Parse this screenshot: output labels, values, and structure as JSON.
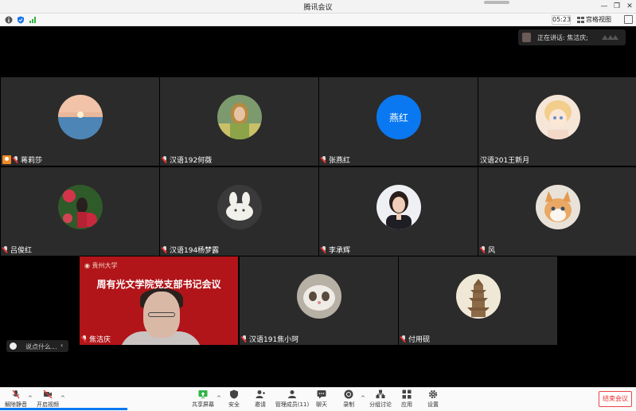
{
  "window": {
    "title": "腾讯会议"
  },
  "subbar": {
    "timer": "05:23",
    "view_label": "宫格视图"
  },
  "speaking": {
    "label": "正在讲话: 焦洁庆;"
  },
  "tiles": [
    {
      "name": "蒋莉莎",
      "host": true,
      "avatar": "sunset-photo"
    },
    {
      "name": "汉语192何薇",
      "avatar": "girl-photo"
    },
    {
      "name": "张燕红",
      "avatar_text": "燕红",
      "color": "#0a78f0"
    },
    {
      "name": "汉语201王新月",
      "avatar": "anime-photo",
      "no_mic": true
    },
    {
      "name": "吕俊红",
      "avatar": "flower-photo"
    },
    {
      "name": "汉语194杨梦露",
      "avatar": "toy-photo"
    },
    {
      "name": "李承辉",
      "avatar": "woman-photo"
    },
    {
      "name": "风",
      "avatar": "kitten-photo"
    },
    {
      "name": "汉语191焦小珂",
      "avatar": "cat-photo"
    },
    {
      "name": "付用砚",
      "avatar": "pagoda-photo"
    }
  ],
  "video": {
    "name": "焦洁庆",
    "logo_text": "贵州大学",
    "banner": "周有光文学院党支部书记会议"
  },
  "chat": {
    "placeholder": "说点什么..."
  },
  "toolbar": {
    "unmute": "解除静音",
    "video": "开启视频",
    "share": "共享屏幕",
    "security": "安全",
    "invite": "邀请",
    "members": "管理成员(11)",
    "chat": "聊天",
    "record": "录制",
    "breakout": "分组讨论",
    "apps": "应用",
    "settings": "设置",
    "end": "结束会议"
  },
  "colors": {
    "accent": "#0a78f0",
    "danger": "#e33333",
    "host_badge": "#f08a24",
    "video_bg": "#b1151a"
  }
}
